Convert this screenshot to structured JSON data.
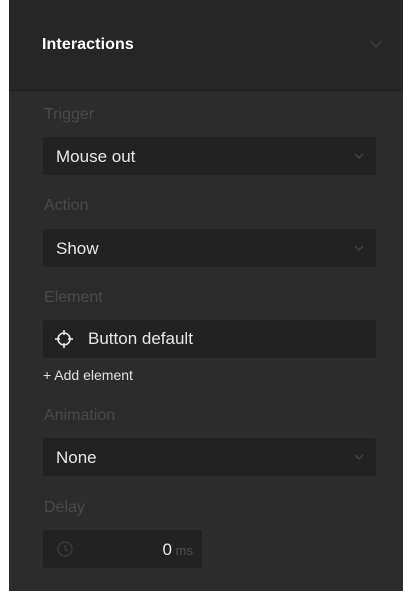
{
  "panel": {
    "title": "Interactions"
  },
  "trigger": {
    "label": "Trigger",
    "value": "Mouse out"
  },
  "action": {
    "label": "Action",
    "value": "Show"
  },
  "element": {
    "label": "Element",
    "value": "Button default",
    "add_label": "+ Add element"
  },
  "animation": {
    "label": "Animation",
    "value": "None"
  },
  "delay": {
    "label": "Delay",
    "value": "0",
    "unit": "ms"
  },
  "icons": {
    "header": "chevron-down-icon",
    "dropdown": "chevron-down-icon",
    "element": "crosshair-target-icon",
    "delay": "clock-icon"
  },
  "colors": {
    "panel_background": "#2c2c2c",
    "header_background": "#262626",
    "field_background": "#222222",
    "label_text": "#4a4a4a",
    "value_text": "#e8e8e8"
  }
}
